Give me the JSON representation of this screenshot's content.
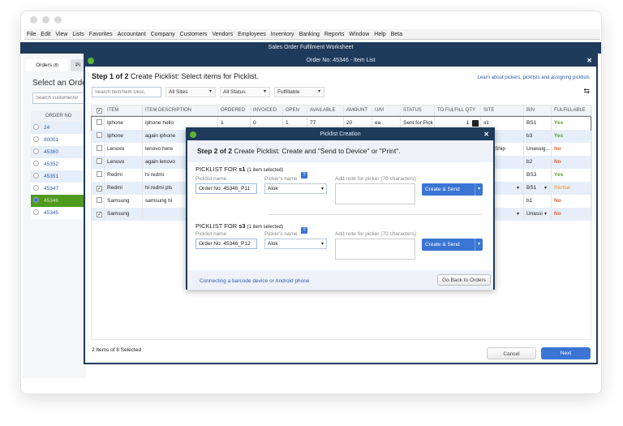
{
  "menu": [
    "File",
    "Edit",
    "View",
    "Lists",
    "Favorites",
    "Accountant",
    "Company",
    "Customers",
    "Vendors",
    "Employees",
    "Inventory",
    "Banking",
    "Reports",
    "Window",
    "Help",
    "Beta"
  ],
  "app_title": "Sales Order Fulfilment Worksheet",
  "left": {
    "tab_orders": "Orders",
    "tab_orders_count": "(8)",
    "tab_other": "Pi",
    "heading": "Select an Order",
    "search_placeholder": "Search customer/or",
    "col_header": "ORDER NO",
    "orders": [
      "24",
      "80001",
      "45360",
      "45352",
      "45351",
      "45347",
      "45346",
      "45345"
    ],
    "selected_order": "45346"
  },
  "item_window": {
    "title": "Order No: 45346 - Item List",
    "step": "Step 1 of 2",
    "step_text": "Create Picklist: Select items for Picklist.",
    "learn_link": "Learn about pickers, picklists and assigning picklists",
    "search_placeholder": "Search Item/Item Desc.",
    "filters": [
      "All Sites",
      "All Status",
      "Fulfillable"
    ],
    "columns": [
      "ITEM",
      "ITEM DESCRIPTION",
      "ORDERED",
      "INVOICED",
      "OPEN",
      "AVAILABLE",
      "AMOUNT",
      "U/M",
      "STATUS",
      "TO FULFILL QTY",
      "SITE",
      "BIN",
      "FULFILLABLE"
    ],
    "rows": [
      {
        "checked": false,
        "cells": [
          "Iphone",
          "iphone hello",
          "1",
          "0",
          "1",
          "77",
          "20",
          "ea",
          "Sent for Pick",
          "1",
          "s1",
          "BS1",
          "Yes"
        ]
      },
      {
        "checked": false,
        "cells": [
          "Iphone",
          "again iphone",
          "",
          "",
          "",
          "",
          "",
          "",
          "",
          "",
          "",
          "b3",
          "Yes"
        ]
      },
      {
        "checked": false,
        "cells": [
          "Lenovo",
          "lenovo here",
          "",
          "",
          "",
          "",
          "",
          "",
          "",
          "",
          "Ship",
          "Unassig...",
          "No"
        ]
      },
      {
        "checked": false,
        "cells": [
          "Lenovo",
          "again lenovo",
          "",
          "",
          "",
          "",
          "",
          "",
          "",
          "",
          "",
          "b2",
          "No"
        ]
      },
      {
        "checked": false,
        "cells": [
          "Redmi",
          "hi redmi",
          "",
          "",
          "",
          "",
          "",
          "",
          "",
          "",
          "",
          "BS3",
          "Yes"
        ]
      },
      {
        "checked": true,
        "cells": [
          "Redmi",
          "hi redmi pls",
          "",
          "",
          "",
          "",
          "",
          "",
          "",
          "",
          "",
          "BS1",
          "Partial"
        ]
      },
      {
        "checked": false,
        "cells": [
          "Samsung",
          "samsung hi",
          "",
          "",
          "",
          "",
          "",
          "",
          "",
          "",
          "",
          "b1",
          "No"
        ]
      },
      {
        "checked": true,
        "cells": [
          "Samsung",
          "",
          "",
          "",
          "",
          "",
          "",
          "",
          "",
          "",
          "",
          "Unassi",
          "No"
        ]
      }
    ],
    "status_colors": {
      "Yes": "#5aa02c",
      "No": "#e0603a",
      "Partial": "#f0a860"
    },
    "footer_count": "2 Items of 8 Selected",
    "cancel": "Cancel",
    "next": "Next"
  },
  "modal": {
    "title": "Picklist Creation",
    "step": "Step 2 of 2",
    "step_text": "Create Picklist: Create and \"Send to Device\" or \"Print\".",
    "sections": [
      {
        "prefix": "PICKLIST FOR ",
        "site": "s1",
        "count": "(1 item selected)",
        "name_label": "Picklist name",
        "name": "Order No: 45346_P11",
        "picker_label": "Picker's name",
        "picker": "Alok",
        "note_label": "Add note for picker (70 characters)",
        "button": "Create & Send"
      },
      {
        "prefix": "PICKLIST FOR ",
        "site": "s3",
        "count": "(1 item selected)",
        "name_label": "Picklist name",
        "name": "Order No: 45346_P12",
        "picker_label": "Picker's name",
        "picker": "Alok",
        "note_label": "Add note for picker (70 characters)",
        "button": "Create & Send"
      }
    ],
    "help": "?",
    "barcode_link": "Connecting a barcode device or Android phone",
    "back_button": "Go Back to Orders"
  }
}
